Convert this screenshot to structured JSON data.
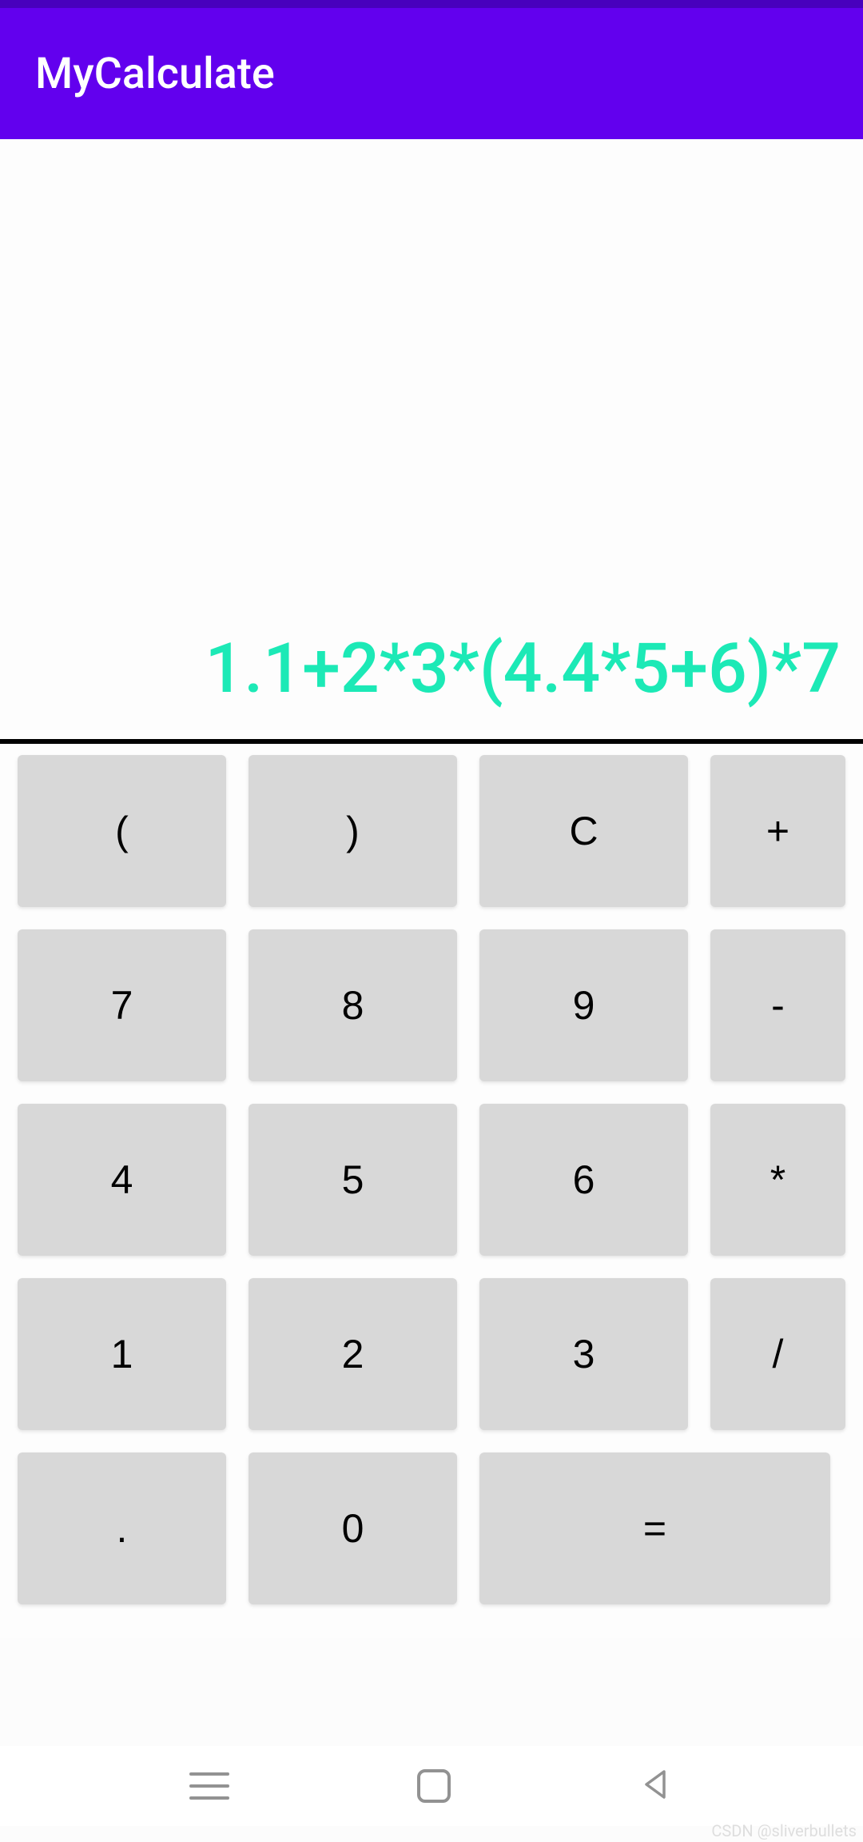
{
  "app": {
    "title": "MyCalculate"
  },
  "display": {
    "expression": "1.1+2*3*(4.4*5+6)*7"
  },
  "keypad": {
    "row1": {
      "k1": "(",
      "k2": ")",
      "k3": "C",
      "k4": "+"
    },
    "row2": {
      "k1": "7",
      "k2": "8",
      "k3": "9",
      "k4": "-"
    },
    "row3": {
      "k1": "4",
      "k2": "5",
      "k3": "6",
      "k4": "*"
    },
    "row4": {
      "k1": "1",
      "k2": "2",
      "k3": "3",
      "k4": "/"
    },
    "row5": {
      "k1": ".",
      "k2": "0",
      "k3": "="
    }
  },
  "watermark": "CSDN @sliverbullets"
}
